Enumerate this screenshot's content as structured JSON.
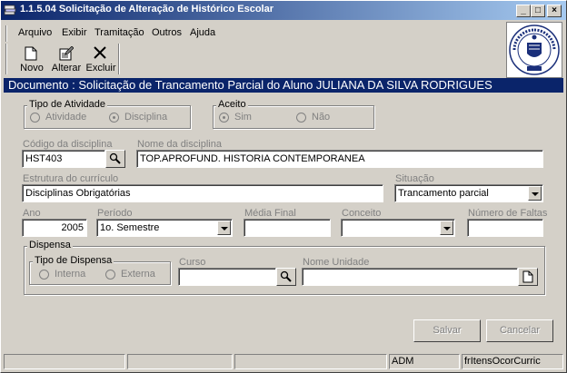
{
  "window": {
    "title": "1.1.5.04 Solicitação de Alteração de Histórico Escolar",
    "minimize_glyph": "_",
    "maximize_glyph": "□",
    "close_glyph": "×"
  },
  "menu": [
    "Arquivo",
    "Exibir",
    "Tramitação",
    "Outros",
    "Ajuda"
  ],
  "toolbar": {
    "new_label": "Novo",
    "edit_label": "Alterar",
    "delete_label": "Excluir",
    "icons": [
      "blank-document-icon",
      "edit-document-icon",
      "x-delete-icon"
    ]
  },
  "document_bar": "Documento : Solicitação de Trancamento Parcial do Aluno JULIANA DA SILVA RODRIGUES",
  "tipo_atividade": {
    "title": "Tipo de Atividade",
    "options": [
      "Atividade",
      "Disciplina"
    ],
    "selected": "Disciplina"
  },
  "aceito": {
    "title": "Aceito",
    "options": [
      "Sim",
      "Não"
    ],
    "selected": "Sim"
  },
  "codigo_disciplina": {
    "label": "Código da disciplina",
    "value": "HST403"
  },
  "nome_disciplina": {
    "label": "Nome da disciplina",
    "value": "TOP.APROFUND. HISTORIA CONTEMPORANEA"
  },
  "estrutura_curriculo": {
    "label": "Estrutura do currículo",
    "value": "Disciplinas Obrigatórias"
  },
  "situacao": {
    "label": "Situação",
    "value": "Trancamento parcial"
  },
  "ano": {
    "label": "Ano",
    "value": "2005"
  },
  "periodo": {
    "label": "Período",
    "value": "1o. Semestre"
  },
  "media_final": {
    "label": "Média Final",
    "value": ""
  },
  "conceito": {
    "label": "Conceito",
    "value": ""
  },
  "numero_faltas": {
    "label": "Número de Faltas",
    "value": ""
  },
  "dispensa": {
    "title": "Dispensa",
    "tipo_title": "Tipo de Dispensa",
    "options": [
      "Interna",
      "Externa"
    ],
    "curso_label": "Curso",
    "curso_value": "",
    "unidade_label": "Nome Unidade",
    "unidade_value": ""
  },
  "buttons": {
    "save": "Salvar",
    "cancel": "Cancelar"
  },
  "statusbar": [
    "",
    "",
    "",
    "ADM",
    "frItensOcorCurric"
  ],
  "colors": {
    "title_start": "#0a246a",
    "title_end": "#a6caf0",
    "doc_bar": "#0a246a",
    "face": "#d4d0c8"
  }
}
